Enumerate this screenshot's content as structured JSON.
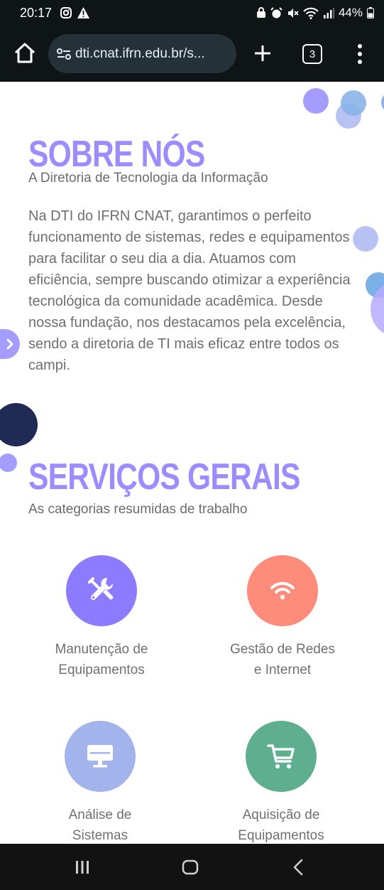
{
  "status_bar": {
    "time": "20:17",
    "battery": "44%"
  },
  "browser": {
    "url": "dti.cnat.ifrn.edu.br/s...",
    "tab_count": "3"
  },
  "about": {
    "title": "SOBRE NÓS",
    "subtitle": "A Diretoria de Tecnologia da Informação",
    "body": "Na DTI do IFRN CNAT, garantimos o perfeito funcionamento de sistemas, redes e equipamentos para facilitar o seu dia a dia. Atuamos com eficiência, sempre buscando otimizar a experiência tecnológica da comunidade acadêmica. Desde nossa fundação, nos destacamos pela excelência, sendo a diretoria de TI mais eficaz entre todos os campi."
  },
  "services": {
    "title": "SERVIÇOS GERAIS",
    "subtitle": "As categorias resumidas de trabalho",
    "items": [
      {
        "label_line1": "Manutenção de",
        "label_line2": "Equipamentos",
        "icon": "tools-icon",
        "color": "#8c7bff"
      },
      {
        "label_line1": "Gestão de Redes",
        "label_line2": "e Internet",
        "icon": "wifi-icon",
        "color": "#ff8b7b"
      },
      {
        "label_line1": "Análise de",
        "label_line2": "Sistemas",
        "icon": "monitor-icon",
        "color": "#a3b3eb"
      },
      {
        "label_line1": "Aquisição de",
        "label_line2": "Equipamentos",
        "icon": "cart-icon",
        "color": "#5daf8f"
      }
    ]
  },
  "colors": {
    "accent": "#9c8dff",
    "status_bg": "#0f1417",
    "url_bg": "#253138"
  }
}
